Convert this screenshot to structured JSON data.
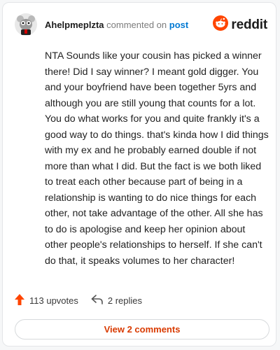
{
  "header": {
    "username": "Ahelpmeplzta",
    "action_text": "commented on",
    "post_link": "post",
    "logo_text": "reddit"
  },
  "comment": {
    "text": "NTA Sounds like your cousin has picked a winner there! Did I say winner? I meant gold digger. You and your boyfriend have been together 5yrs and although you are still young that counts for a lot. You do what works for you and quite frankly it's a good way to do things. that's kinda how I did things with my ex and he probably earned double if not more than what I did. But the fact is we both liked to treat each other because part of being in a relationship is wanting to do nice things for each other, not take advantage of the other. All she has to do is apologise and keep her opinion about other people's relationships to herself. If she can't do that, it speaks volumes to her character!"
  },
  "actions": {
    "upvotes_label": "113 upvotes",
    "replies_label": "2 replies"
  },
  "footer": {
    "view_comments_label": "View 2 comments"
  },
  "colors": {
    "brand": "#ff4500",
    "link": "#0079d3",
    "view_button_text": "#d93a00"
  },
  "icons": [
    "snoo-avatar-icon",
    "reddit-logo-icon",
    "upvote-arrow-icon",
    "reply-arrow-icon"
  ]
}
